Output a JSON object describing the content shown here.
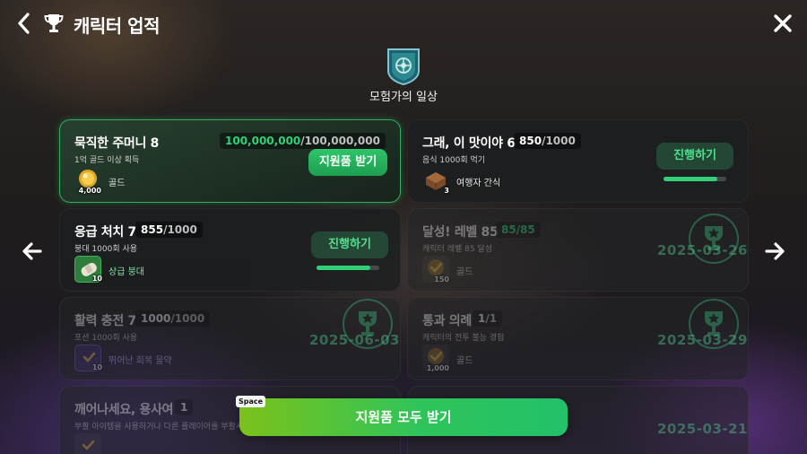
{
  "header": {
    "title": "캐릭터 업적"
  },
  "category": {
    "name": "모험가의 일상"
  },
  "cards": [
    {
      "name": "묵직한 주머니 8",
      "progress_current": "100,000,000",
      "progress_max": "/100,000,000",
      "description": "1억 골드 이상 획득",
      "reward_qty": "4,000",
      "reward_name": "골드",
      "button": "지원품 받기",
      "status": "claimable"
    },
    {
      "name": "그래, 이 맛이야 6",
      "progress_current": "850",
      "progress_max": "/1000",
      "description": "음식 1000회 먹기",
      "reward_qty": "3",
      "reward_name": "여행자 간식",
      "button": "진행하기",
      "progress_fraction": 0.85,
      "status": "in-progress"
    },
    {
      "name": "응급 처치 7",
      "progress_current": "855",
      "progress_max": "/1000",
      "description": "붕대 1000회 사용",
      "reward_qty": "10",
      "reward_name": "상급 붕대",
      "button": "진행하기",
      "progress_fraction": 0.855,
      "status": "in-progress"
    },
    {
      "name": "달성! 레벨 85",
      "progress_current": "85",
      "progress_max": "/85",
      "description": "캐릭터 레벨 85 달성",
      "reward_qty": "150",
      "reward_name": "골드",
      "date": "2025-03-26",
      "status": "completed"
    },
    {
      "name": "활력 충전 7",
      "progress_current": "1000",
      "progress_max": "/1000",
      "description": "포션 1000회 사용",
      "reward_qty": "10",
      "reward_name": "뛰어난 회복 물약",
      "date": "2025-06-03",
      "status": "completed"
    },
    {
      "name": "통과 의례",
      "progress_current": "1",
      "progress_max": "/1",
      "description": "캐릭터의 전투 불능 경험",
      "reward_qty": "1,000",
      "reward_name": "골드",
      "date": "2025-03-29",
      "status": "completed"
    },
    {
      "name": "깨어나세요, 용사여",
      "progress_current": "1",
      "progress_max": "",
      "description": "부활 아이템을 사용하거나 다른 플레이어를 부활시",
      "reward_qty": "",
      "reward_name": "",
      "date": "2025-03-21",
      "status": "completed"
    }
  ],
  "footer": {
    "claim_all_label": "지원품 모두 받기",
    "hotkey": "Space"
  },
  "colors": {
    "accent_green": "#2fd27a",
    "claim_gradient_start": "#7bc21a",
    "claim_gradient_end": "#22c16a"
  },
  "icons": [
    "back-arrow-icon",
    "trophy-icon",
    "close-icon",
    "arrow-left-icon",
    "arrow-right-icon",
    "gold-coin-icon",
    "snack-icon",
    "bandage-icon",
    "potion-icon",
    "laurel-trophy-icon"
  ]
}
